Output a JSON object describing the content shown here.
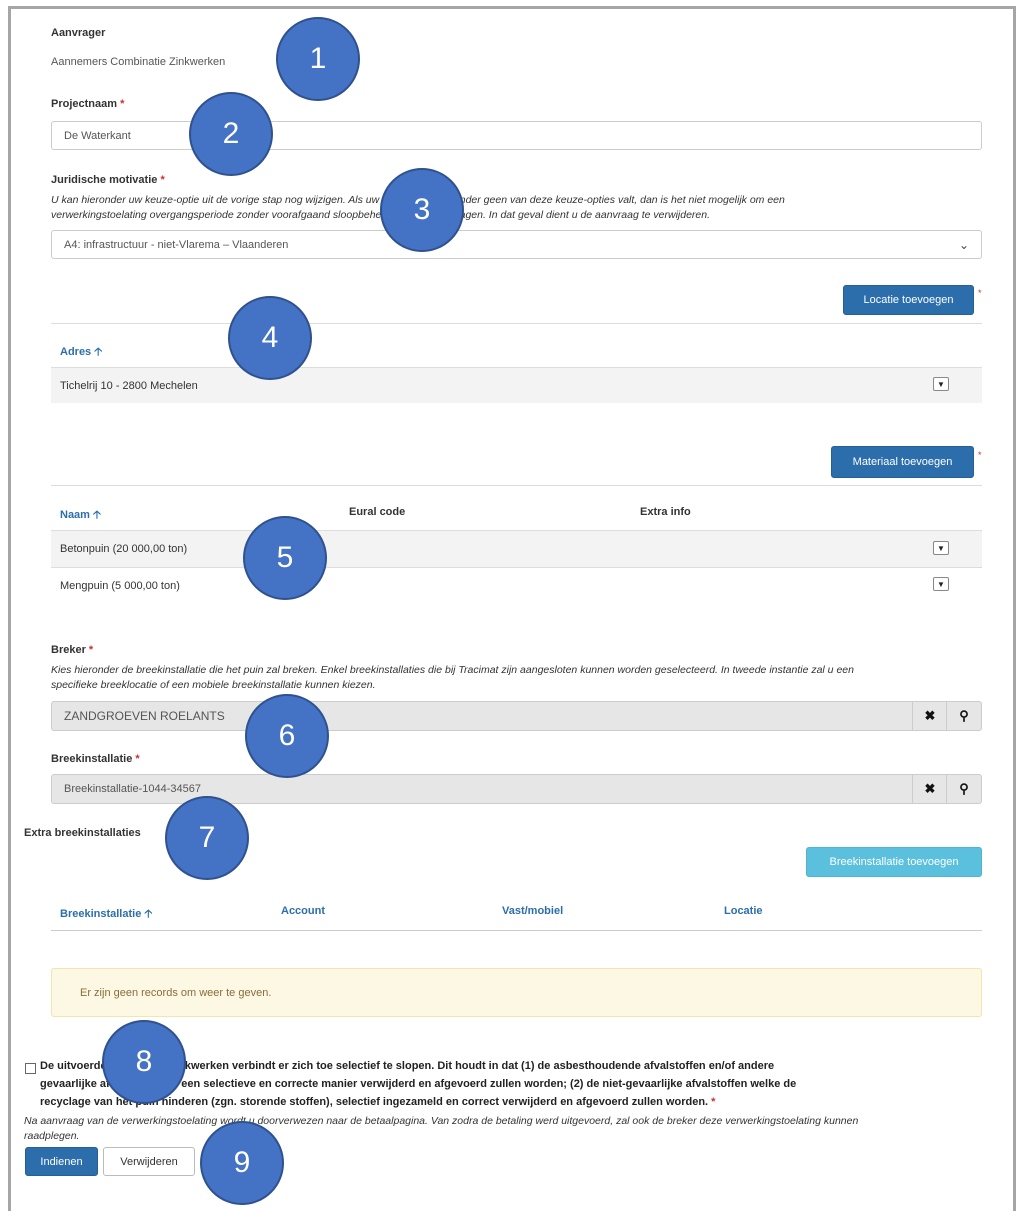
{
  "aanvrager": {
    "label": "Aanvrager",
    "value": "Aannemers Combinatie Zinkwerken"
  },
  "projectnaam": {
    "label": "Projectnaam",
    "required_mark": "*",
    "value": "De Waterkant"
  },
  "juridische": {
    "label": "Juridische motivatie",
    "required_mark": "*",
    "help_line1": "U kan hieronder uw keuze-optie uit de vorige stap nog wijzigen. Als uw betrokken werf onder geen van deze keuze-opties valt, dan is het niet mogelijk om een",
    "help_line2": "verwerkingstoelating overgangsperiode zonder voorafgaand sloopbeheersplan aan te vragen. In dat geval dient u de aanvraag te verwijderen.",
    "selected": "A4: infrastructuur - niet-Vlarema – Vlaanderen"
  },
  "locatie": {
    "add_button": "Locatie toevoegen",
    "required_mark": "*",
    "col_adres": "Adres",
    "rows": [
      "Tichelrij 10 - 2800 Mechelen"
    ]
  },
  "materiaal": {
    "add_button": "Materiaal toevoegen",
    "required_mark": "*",
    "col_naam": "Naam",
    "col_eural": "Eural code",
    "col_extra": "Extra info",
    "rows": [
      "Betonpuin (20 000,00 ton)",
      "Mengpuin (5 000,00 ton)"
    ]
  },
  "breker": {
    "label": "Breker",
    "required_mark": "*",
    "help_line1": "Kies hieronder de breekinstallatie die het puin zal breken. Enkel breekinstallaties die bij Tracimat zijn aangesloten kunnen worden geselecteerd. In tweede instantie zal u een",
    "help_line2": "specifieke breeklocatie of een mobiele breekinstallatie kunnen kiezen.",
    "value": "ZANDGROEVEN ROELANTS"
  },
  "breekinstallatie": {
    "label": "Breekinstallatie",
    "required_mark": "*",
    "value": "Breekinstallatie-1044-34567"
  },
  "extra": {
    "label": "Extra breekinstallaties",
    "add_button": "Breekinstallatie toevoegen",
    "col_breek": "Breekinstallatie",
    "col_account": "Account",
    "col_vast": "Vast/mobiel",
    "col_locatie": "Locatie",
    "empty": "Er zijn geen records om weer te geven."
  },
  "declaration": {
    "line1": "De uitvoerder van de afbraakwerken verbindt er zich toe selectief te slopen. Dit houdt in dat (1) de asbesthoudende afvalstoffen en/of andere",
    "line2": "gevaarlijke afvalstoffen op een selectieve en correcte manier verwijderd en afgevoerd zullen worden; (2) de niet-gevaarlijke afvalstoffen welke de",
    "line3": "recyclage van het puin hinderen (zgn. storende stoffen), selectief ingezameld en correct verwijderd en afgevoerd zullen worden.",
    "required_mark": "*",
    "note_line1": "Na aanvraag van de verwerkingstoelating wordt u doorverwezen naar de betaalpagina. Van zodra de betaling werd uitgevoerd, zal ook de breker deze verwerkingstoelating kunnen",
    "note_line2": "raadplegen."
  },
  "actions": {
    "submit": "Indienen",
    "delete": "Verwijderen"
  },
  "markers": [
    "1",
    "2",
    "3",
    "4",
    "5",
    "6",
    "7",
    "8",
    "9"
  ],
  "icons": {
    "sort_up": "arrow-up-icon",
    "chevron": "chevron-down-icon",
    "clear": "times-icon",
    "search": "search-icon"
  },
  "colors": {
    "primary": "#2c6eab",
    "info": "#5bc0de",
    "marker": "#4472c4",
    "warning_bg": "#fcf8e3"
  }
}
